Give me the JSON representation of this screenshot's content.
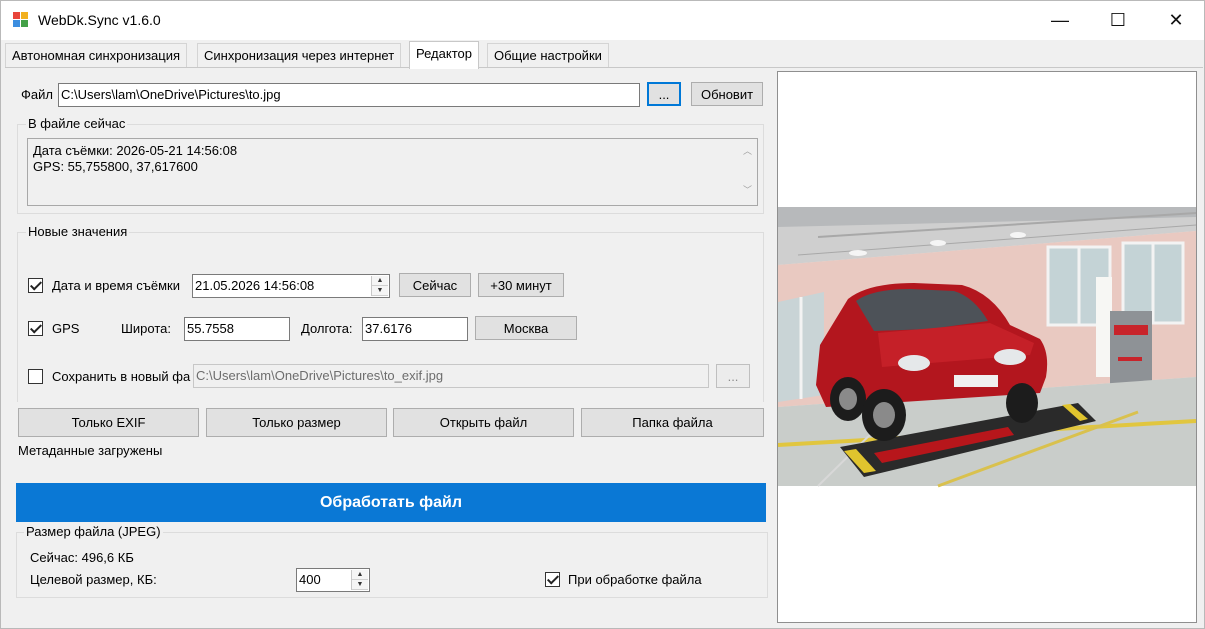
{
  "window": {
    "title": "WebDk.Sync v1.6.0",
    "minimize": "—",
    "maximize": "☐",
    "close": "✕"
  },
  "tabs": [
    {
      "label": "Автономная синхронизация"
    },
    {
      "label": "Синхронизация через интернет"
    },
    {
      "label": "Редактор"
    },
    {
      "label": "Общие настройки"
    }
  ],
  "file": {
    "label": "Файл",
    "path": "C:\\Users\\lam\\OneDrive\\Pictures\\to.jpg",
    "browse": "...",
    "refresh": "Обновит"
  },
  "current": {
    "title": "В файле сейчас",
    "line1": "Дата съёмки: 2026-05-21 14:56:08",
    "line2": "GPS: 55,755800, 37,617600"
  },
  "new_values": {
    "title": "Новые значения",
    "datetime_label": "Дата и время съёмки",
    "datetime_value": "21.05.2026 14:56:08",
    "now_button": "Сейчас",
    "plus30_button": "+30 минут",
    "gps_label": "GPS",
    "lat_label": "Широта:",
    "lat_value": "55.7558",
    "lon_label": "Долгота:",
    "lon_value": "37.6176",
    "moscow_button": "Москва",
    "save_new_label": "Сохранить в новый фа",
    "save_new_path": "C:\\Users\\lam\\OneDrive\\Pictures\\to_exif.jpg",
    "save_new_browse": "..."
  },
  "actions": {
    "exif_only": "Только EXIF",
    "size_only": "Только размер",
    "open_file": "Открыть файл",
    "file_folder": "Папка файла"
  },
  "status": "Метаданные загружены",
  "process_button": "Обработать файл",
  "size": {
    "title": "Размер файла (JPEG)",
    "current": "Сейчас: 496,6 КБ",
    "target_label": "Целевой размер, КБ:",
    "target_value": "400",
    "on_process_label": "При обработке файла"
  },
  "colors": {
    "accent": "#0a78d5",
    "car": "#b3161e"
  }
}
